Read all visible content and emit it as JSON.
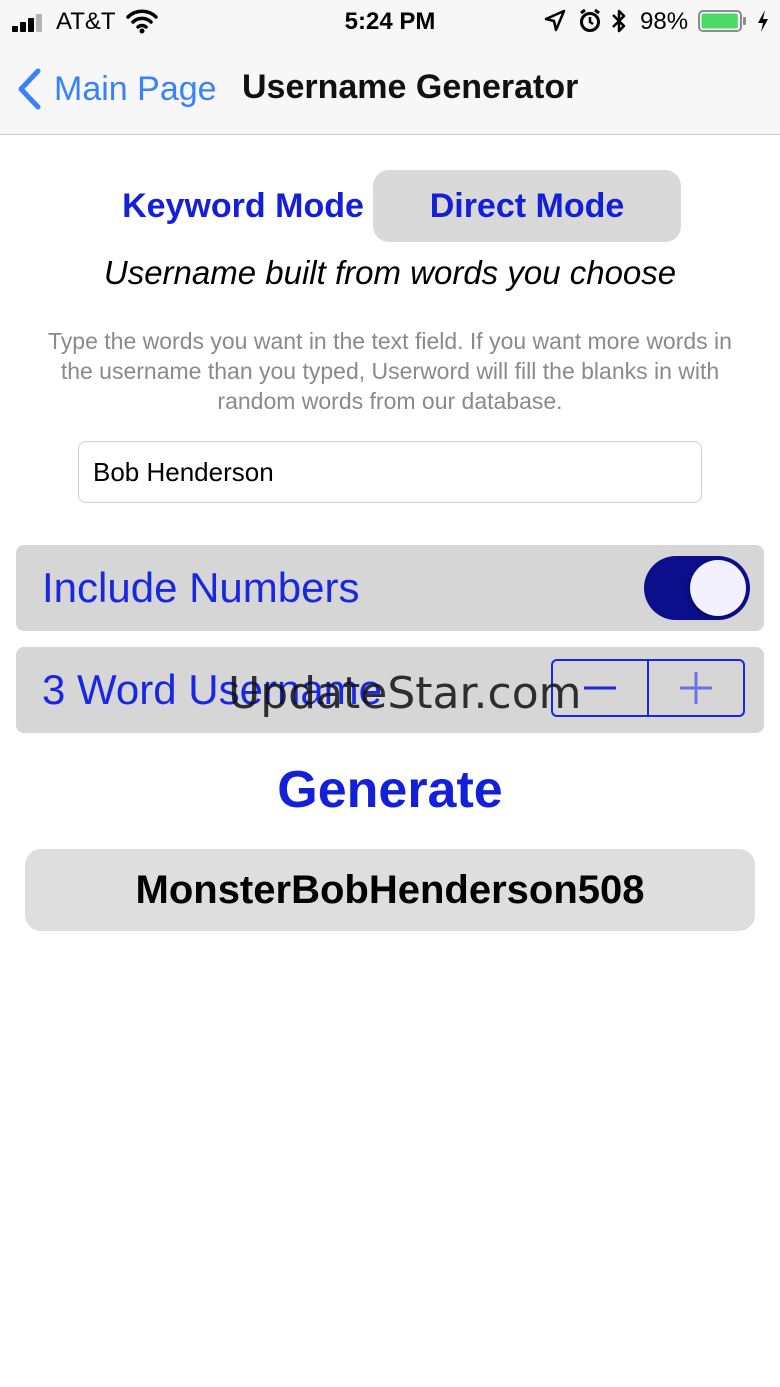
{
  "status_bar": {
    "carrier": "AT&T",
    "time": "5:24 PM",
    "battery_percent": "98%",
    "battery_level": 0.98,
    "icons": [
      "signal-icon",
      "wifi-icon",
      "location-icon",
      "alarm-icon",
      "bluetooth-icon",
      "battery-icon",
      "charging-icon"
    ]
  },
  "nav": {
    "back_label": "Main Page",
    "title": "Username Generator"
  },
  "mode_selector": {
    "keyword_label": "Keyword Mode",
    "direct_label": "Direct Mode",
    "selected": "Direct Mode"
  },
  "subtitle": "Username built from words you choose",
  "description": "Type the words you want in the text field. If you want more words in the username than you typed, Userword will fill the blanks in with random words from our database.",
  "words_field": {
    "value": "Bob Henderson"
  },
  "include_numbers": {
    "label": "Include Numbers",
    "on": true
  },
  "word_count": {
    "label": "3 Word Username",
    "minus": "−",
    "plus": "+"
  },
  "watermark": "UpdateStar.com",
  "generate_label": "Generate",
  "result": "MonsterBobHenderson508",
  "colors": {
    "accent": "#1420d8",
    "ios_blue": "#3a82f7",
    "toggle_on": "#0c0f8c",
    "battery_green": "#4cd964"
  }
}
